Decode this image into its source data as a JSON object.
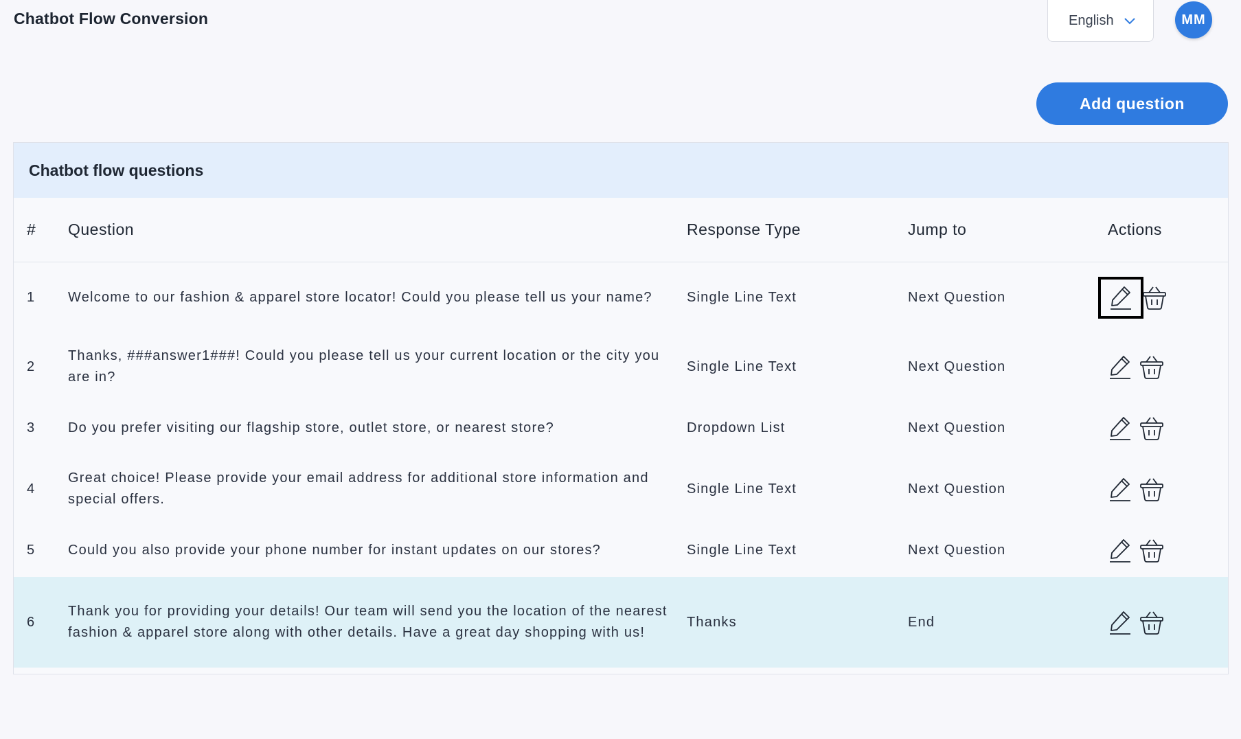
{
  "header": {
    "title": "Chatbot Flow Conversion",
    "language": "English",
    "avatar_initials": "MM"
  },
  "toolbar": {
    "add_question_label": "Add question"
  },
  "panel": {
    "title": "Chatbot flow questions",
    "columns": {
      "num": "#",
      "question": "Question",
      "response_type": "Response Type",
      "jump_to": "Jump to",
      "actions": "Actions"
    },
    "rows": [
      {
        "num": "1",
        "question": "Welcome to our fashion & apparel store locator! Could you please tell us your name?",
        "response_type": "Single Line Text",
        "jump_to": "Next Question"
      },
      {
        "num": "2",
        "question": "Thanks, ###answer1###! Could you please tell us your current location or the city you are in?",
        "response_type": "Single Line Text",
        "jump_to": "Next Question"
      },
      {
        "num": "3",
        "question": "Do you prefer visiting our flagship store, outlet store, or nearest store?",
        "response_type": "Dropdown List",
        "jump_to": "Next Question"
      },
      {
        "num": "4",
        "question": "Great choice! Please provide your email address for additional store information and special offers.",
        "response_type": "Single Line Text",
        "jump_to": "Next Question"
      },
      {
        "num": "5",
        "question": "Could you also provide your phone number for instant updates on our stores?",
        "response_type": "Single Line Text",
        "jump_to": "Next Question"
      },
      {
        "num": "6",
        "question": "Thank you for providing your details! Our team will send you the location of the nearest fashion & apparel store along with other details. Have a great day shopping with us!",
        "response_type": "Thanks",
        "jump_to": "End"
      }
    ]
  },
  "icons": {
    "edit": "pencil-icon",
    "delete": "basket-icon",
    "dropdown": "chevron-down-icon"
  },
  "colors": {
    "accent": "#2f7be0",
    "panel_header_bg": "#e3eefc",
    "highlight_row_bg": "#def1f7"
  }
}
